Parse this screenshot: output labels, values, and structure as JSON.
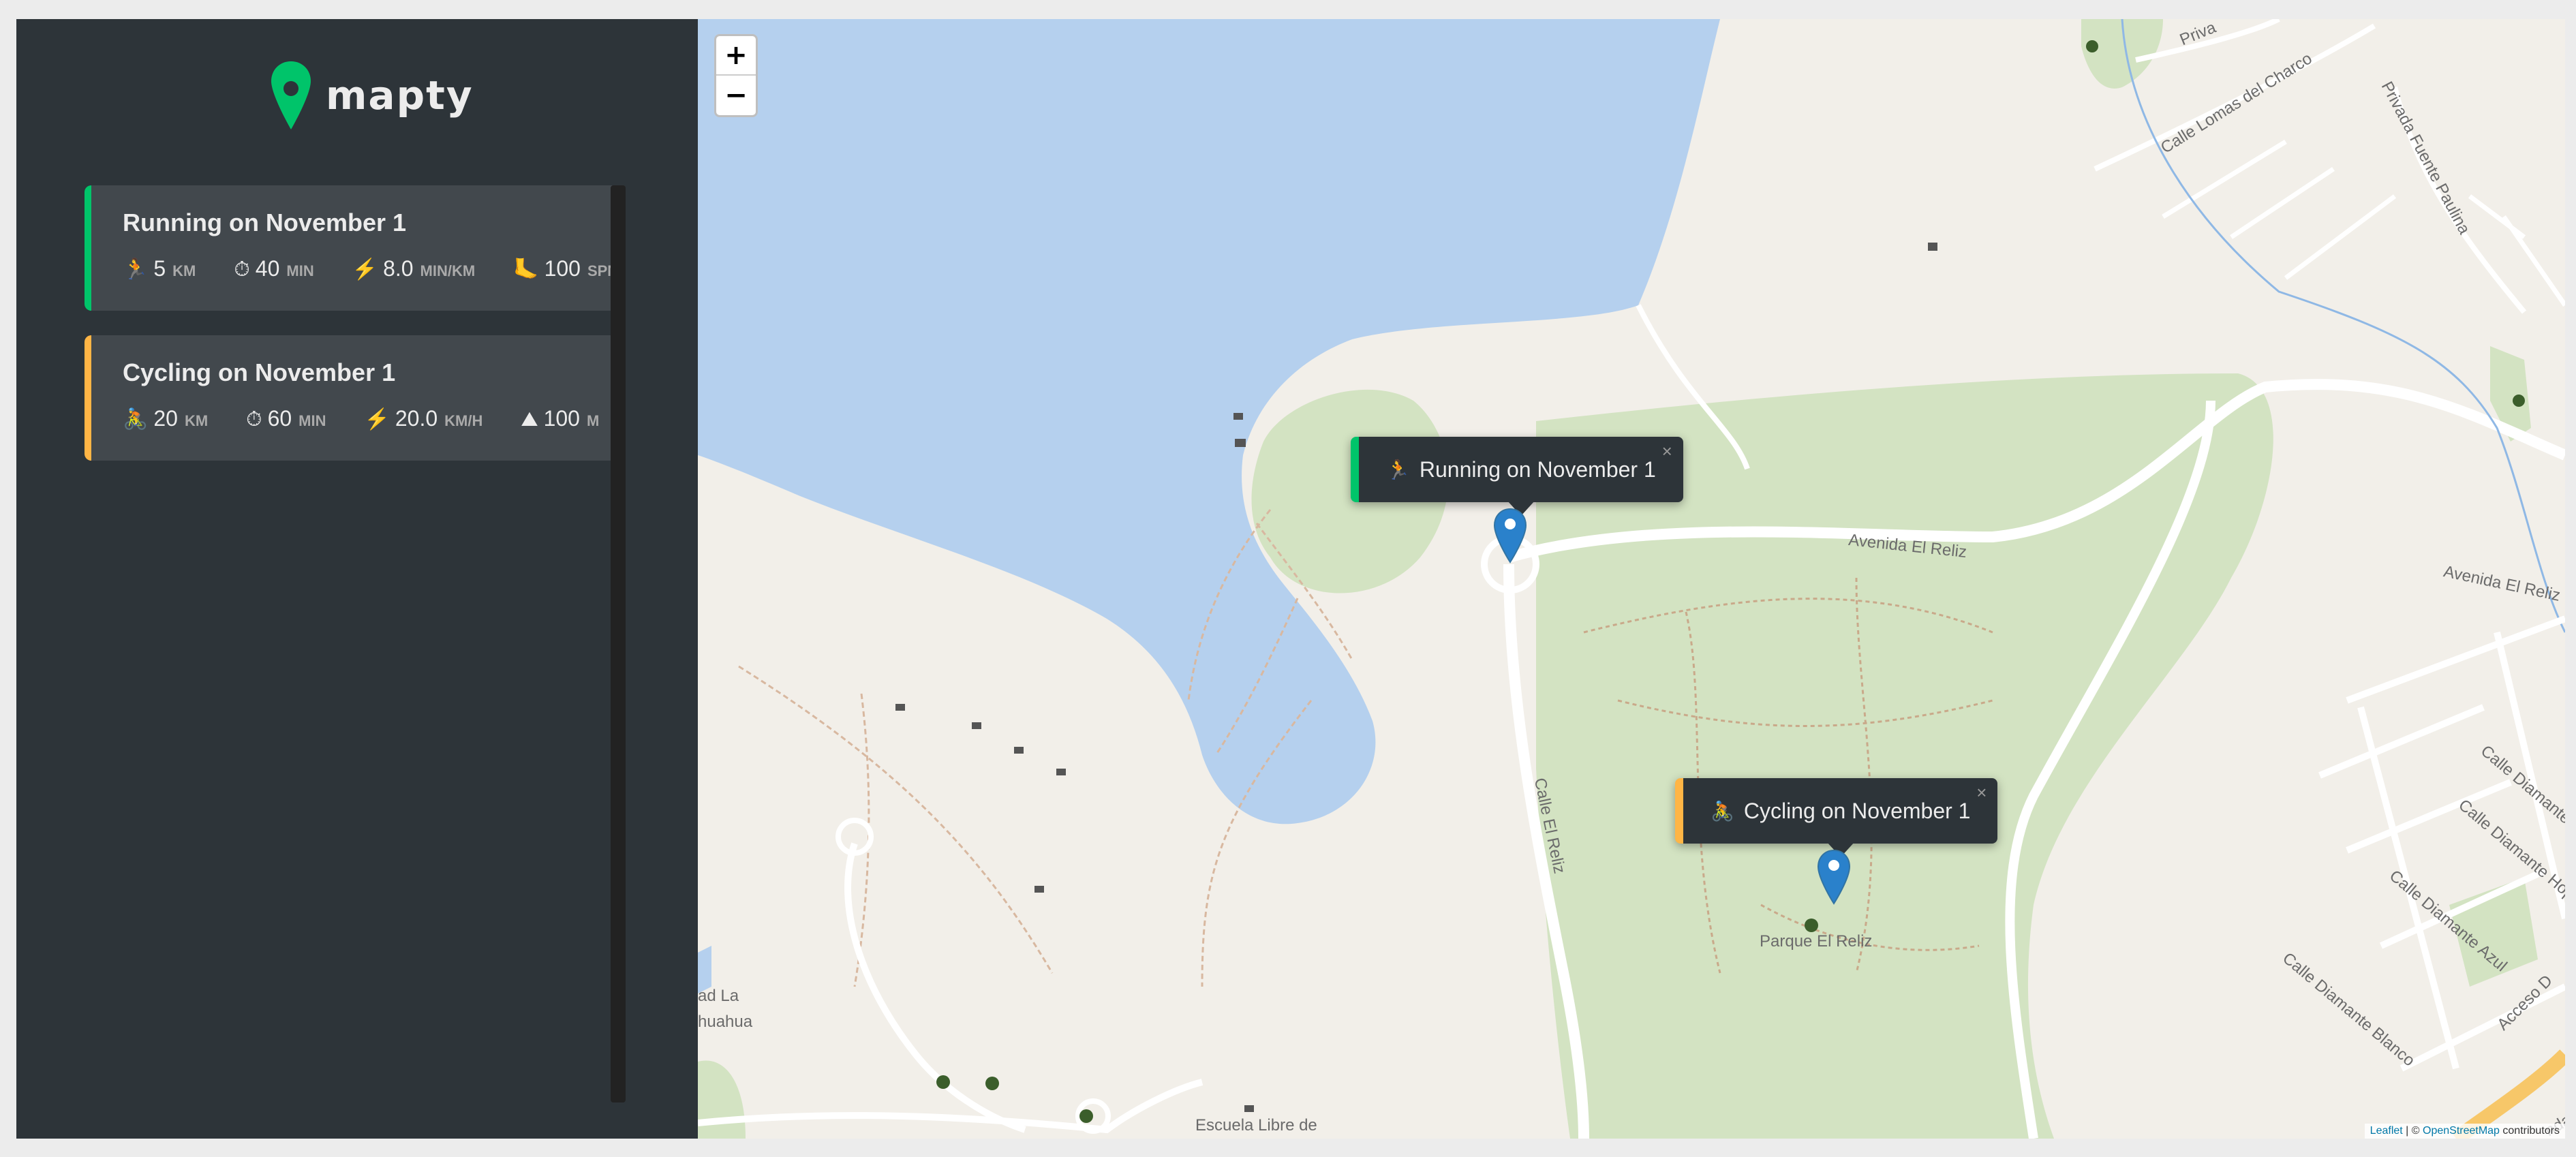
{
  "app": {
    "name": "mapty"
  },
  "workouts": [
    {
      "type": "running",
      "title": "Running on November 1",
      "details": [
        {
          "icon": "🏃",
          "value": "5",
          "unit": "km"
        },
        {
          "icon": "⏱",
          "value": "40",
          "unit": "min"
        },
        {
          "icon": "⚡️",
          "value": "8.0",
          "unit": "min/km"
        },
        {
          "icon": "🦶",
          "value": "100",
          "unit": "spm"
        }
      ]
    },
    {
      "type": "cycling",
      "title": "Cycling on November 1",
      "details": [
        {
          "icon": "🚴",
          "value": "20",
          "unit": "km"
        },
        {
          "icon": "⏱",
          "value": "60",
          "unit": "min"
        },
        {
          "icon": "⚡️",
          "value": "20.0",
          "unit": "km/h"
        },
        {
          "icon": "⛰",
          "value": "100",
          "unit": "m"
        }
      ]
    }
  ],
  "map": {
    "zoom_in": "+",
    "zoom_out": "−",
    "popups": [
      {
        "type": "running",
        "emoji": "🏃",
        "text": "Running on November 1",
        "close": "×"
      },
      {
        "type": "cycling",
        "emoji": "🚴",
        "text": "Cycling on November 1",
        "close": "×"
      }
    ],
    "labels": {
      "avenida_1": "Avenida El Reliz",
      "avenida_2": "Avenida El Reliz",
      "calle_reliz": "Calle El Reliz",
      "parque": "Parque El Reliz",
      "lomas": "Calle Lomas del Charco",
      "privada": "Privada Fuente Paulina",
      "priv_top": "Priva",
      "diam_1": "Calle Diamante",
      "diam_2": "Calle Diamante Hope",
      "diam_azul": "Calle Diamante Azul",
      "diam_blanco": "Calle Diamante Blanco",
      "acceso": "Acceso D",
      "escuela": "Escuela Libre de",
      "left_1": "ad La",
      "left_2": "huahua",
      "bottom_right": "nda"
    },
    "attribution": {
      "leaflet": "Leaflet",
      "sep": " | © ",
      "osm": "OpenStreetMap",
      "rest": " contributors"
    },
    "colors": {
      "water": "#b5d0ee",
      "park": "#d3e3c2",
      "land": "#f2efe9",
      "marker": "#2a81cb"
    }
  }
}
